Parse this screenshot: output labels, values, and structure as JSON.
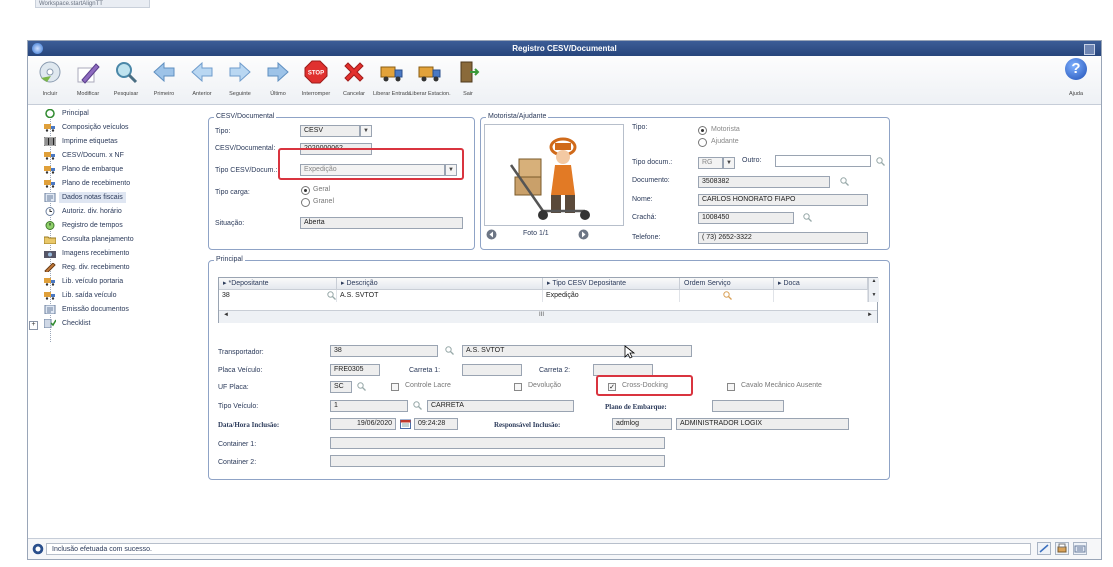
{
  "top_tab": "Workspace.startAlignTT",
  "window": {
    "title": "Registro CESV/Documental"
  },
  "toolbar": [
    {
      "label": "Incluir",
      "icon": "cd-add-icon"
    },
    {
      "label": "Modificar",
      "icon": "pencil-icon"
    },
    {
      "label": "Pesquisar",
      "icon": "magnifier-icon"
    },
    {
      "label": "Primeiro",
      "icon": "first-arrow-icon"
    },
    {
      "label": "Anterior",
      "icon": "previous-arrow-icon"
    },
    {
      "label": "Seguinte",
      "icon": "next-arrow-icon"
    },
    {
      "label": "Último",
      "icon": "last-arrow-icon"
    },
    {
      "label": "Interromper",
      "icon": "stop-icon"
    },
    {
      "label": "Cancelar",
      "icon": "cancel-x-icon"
    },
    {
      "label": "Liberar Entrada",
      "icon": "truck-entry-icon"
    },
    {
      "label": "Liberar Estacion.",
      "icon": "truck-parking-icon"
    },
    {
      "label": "Sair",
      "icon": "exit-door-icon"
    }
  ],
  "help": {
    "label": "Ajuda"
  },
  "tree": [
    {
      "label": "Principal",
      "icon": "circle-icon"
    },
    {
      "label": "Composição veículos",
      "icon": "truck-icon"
    },
    {
      "label": "Imprime etiquetas",
      "icon": "barcode-icon"
    },
    {
      "label": "CESV/Docum. x NF",
      "icon": "truck-icon"
    },
    {
      "label": "Plano de embarque",
      "icon": "truck-icon"
    },
    {
      "label": "Plano de recebimento",
      "icon": "truck-icon"
    },
    {
      "label": "Dados notas fiscais",
      "icon": "document-icon"
    },
    {
      "label": "Autoriz. div. horário",
      "icon": "clock-icon"
    },
    {
      "label": "Registro de tempos",
      "icon": "timer-icon"
    },
    {
      "label": "Consulta planejamento",
      "icon": "folder-icon"
    },
    {
      "label": "Imagens recebimento",
      "icon": "camera-icon"
    },
    {
      "label": "Reg. div. recebimento",
      "icon": "pen-icon"
    },
    {
      "label": "Lib. veículo portaria",
      "icon": "truck-icon"
    },
    {
      "label": "Lib. saída veículo",
      "icon": "truck-icon"
    },
    {
      "label": "Emissão documentos",
      "icon": "document-icon"
    },
    {
      "label": "Checklist",
      "icon": "checklist-icon"
    }
  ],
  "cesv": {
    "legend": "CESV/Documental",
    "tipo_label": "Tipo:",
    "tipo_value": "CESV",
    "documental_label": "CESV/Documental:",
    "documental_value": "2020000062",
    "tipo_docum_label": "Tipo CESV/Docum.:",
    "tipo_docum_value": "Expedição",
    "tipo_carga_label": "Tipo carga:",
    "carga_options": [
      "Geral",
      "Granel"
    ],
    "situacao_label": "Situação:",
    "situacao_value": "Aberta"
  },
  "motorista": {
    "legend": "Motorista/Ajudante",
    "photo_label": "Foto 1/1",
    "tipo_label": "Tipo:",
    "tipo_options": [
      "Motorista",
      "Ajudante"
    ],
    "tipo_docum_label": "Tipo docum.:",
    "tipo_docum_value": "RG",
    "outro_label": "Outro:",
    "documento_label": "Documento:",
    "documento_value": "3508382",
    "nome_label": "Nome:",
    "nome_value": "CARLOS HONORATO FIAPO",
    "cracha_label": "Crachá:",
    "cracha_value": "1008450",
    "telefone_label": "Telefone:",
    "telefone_value": "( 73) 2652-3322"
  },
  "principal": {
    "legend": "Principal",
    "columns": [
      "*Depositante",
      "Descrição",
      "Tipo CESV Depositante",
      "Ordem Serviço",
      "Doca"
    ],
    "row": [
      "38",
      "A.S. SVTOT",
      "Expedição",
      "",
      ""
    ],
    "scroll_mark": "III",
    "transportador_label": "Transportador:",
    "transportador_code": "38",
    "transportador_name": "A.S. SVTOT",
    "placa_label": "Placa Veículo:",
    "placa_value": "FRE0305",
    "carreta1_label": "Carreta 1:",
    "carreta2_label": "Carreta 2:",
    "uf_label": "UF Placa:",
    "uf_value": "SC",
    "controle_lacre": "Controle Lacre",
    "devolucao": "Devolução",
    "cross_docking": "Cross-Docking",
    "cavalo": "Cavalo Mecânico Ausente",
    "tipo_veiculo_label": "Tipo Veículo:",
    "tipo_veiculo_code": "1",
    "tipo_veiculo_name": "CARRETA",
    "plano_label": "Plano de Embarque:",
    "data_label": "Data/Hora Inclusão:",
    "data_value": "19/06/2020",
    "hora_value": "09:24:28",
    "resp_label": "Responsável Inclusão:",
    "resp_user": "admlog",
    "resp_name": "ADMINISTRADOR LOGIX",
    "container1_label": "Container 1:",
    "container2_label": "Container 2:"
  },
  "status": {
    "message": "Inclusão efetuada com sucesso."
  }
}
